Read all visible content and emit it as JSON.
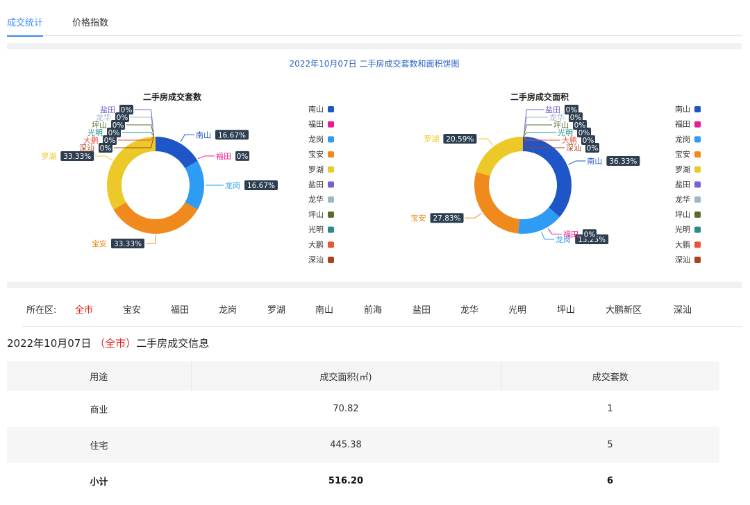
{
  "tabs": [
    {
      "label": "成交统计",
      "active": true
    },
    {
      "label": "价格指数",
      "active": false
    }
  ],
  "chart_title": "2022年10月07日 二手房成交套数和面积饼图",
  "chart_data": [
    {
      "type": "pie",
      "title": "二手房成交套数",
      "slices": [
        {
          "name": "南山",
          "value": 16.67,
          "label": "16.67%",
          "color": "#1e56c8"
        },
        {
          "name": "福田",
          "value": 0,
          "label": "0%",
          "color": "#e81e8c"
        },
        {
          "name": "龙岗",
          "value": 16.67,
          "label": "16.67%",
          "color": "#2e9cf5"
        },
        {
          "name": "宝安",
          "value": 33.33,
          "label": "33.33%",
          "color": "#f08a1c"
        },
        {
          "name": "罗湖",
          "value": 33.33,
          "label": "33.33%",
          "color": "#ecc928"
        },
        {
          "name": "盐田",
          "value": 0,
          "label": "0%",
          "color": "#7b5fd0"
        },
        {
          "name": "龙华",
          "value": 0,
          "label": "0%",
          "color": "#9cb8c8"
        },
        {
          "name": "坪山",
          "value": 0,
          "label": "0%",
          "color": "#556b2f"
        },
        {
          "name": "光明",
          "value": 0,
          "label": "0%",
          "color": "#2a8b8b"
        },
        {
          "name": "大鹏",
          "value": 0,
          "label": "0%",
          "color": "#e8543c"
        },
        {
          "name": "深汕",
          "value": 0,
          "label": "0%",
          "color": "#a8431e"
        }
      ]
    },
    {
      "type": "pie",
      "title": "二手房成交面积",
      "slices": [
        {
          "name": "南山",
          "value": 36.33,
          "label": "36.33%",
          "color": "#1e56c8"
        },
        {
          "name": "福田",
          "value": 0,
          "label": "0%",
          "color": "#e81e8c"
        },
        {
          "name": "龙岗",
          "value": 15.25,
          "label": "15.25%",
          "color": "#2e9cf5"
        },
        {
          "name": "宝安",
          "value": 27.83,
          "label": "27.83%",
          "color": "#f08a1c"
        },
        {
          "name": "罗湖",
          "value": 20.59,
          "label": "20.59%",
          "color": "#ecc928"
        },
        {
          "name": "盐田",
          "value": 0,
          "label": "0%",
          "color": "#7b5fd0"
        },
        {
          "name": "龙华",
          "value": 0,
          "label": "0%",
          "color": "#9cb8c8"
        },
        {
          "name": "坪山",
          "value": 0,
          "label": "0%",
          "color": "#556b2f"
        },
        {
          "name": "光明",
          "value": 0,
          "label": "0%",
          "color": "#2a8b8b"
        },
        {
          "name": "大鹏",
          "value": 0,
          "label": "0%",
          "color": "#e8543c"
        },
        {
          "name": "深汕",
          "value": 0,
          "label": "0%",
          "color": "#a8431e"
        }
      ]
    }
  ],
  "filter": {
    "label": "所在区:",
    "items": [
      "全市",
      "宝安",
      "福田",
      "龙岗",
      "罗湖",
      "南山",
      "前海",
      "盐田",
      "龙华",
      "光明",
      "坪山",
      "大鹏新区",
      "深汕"
    ],
    "active_index": 0
  },
  "info": {
    "date": "2022年10月07日",
    "region": "（全市）",
    "suffix": "二手房成交信息"
  },
  "table": {
    "headers": [
      "用途",
      "成交面积(㎡)",
      "成交套数"
    ],
    "rows": [
      [
        "商业",
        "70.82",
        "1"
      ],
      [
        "住宅",
        "445.38",
        "5"
      ]
    ],
    "total": [
      "小计",
      "516.20",
      "6"
    ]
  }
}
